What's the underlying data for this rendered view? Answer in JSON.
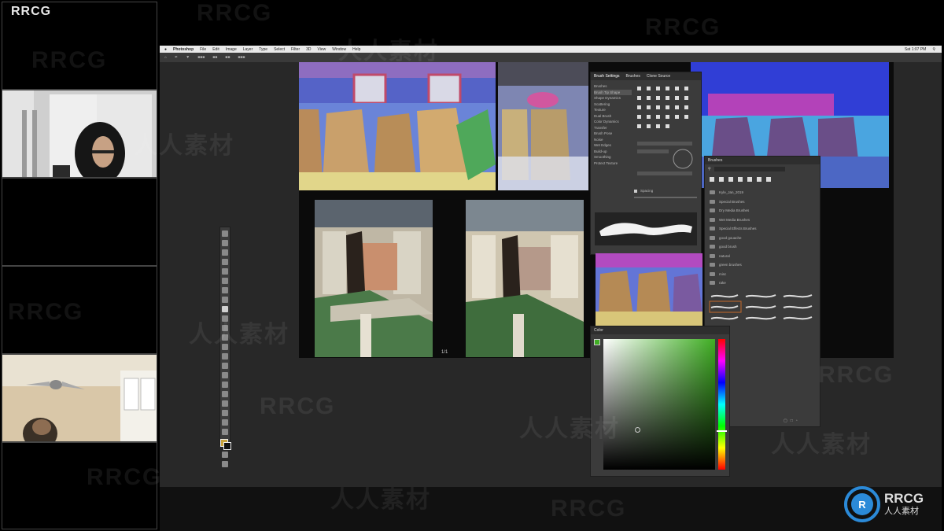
{
  "brand": {
    "top_left": "RRCG",
    "logo_title": "RRCG",
    "logo_subtitle": "人人素材"
  },
  "watermarks": [
    "RRCG",
    "人人素材"
  ],
  "ps": {
    "menu": [
      "Photoshop",
      "File",
      "Edit",
      "Image",
      "Layer",
      "Type",
      "Select",
      "Filter",
      "3D",
      "View",
      "Window",
      "Help"
    ],
    "clock": "Sat 1:07 PM"
  },
  "brush_settings_panel": {
    "tabs": [
      "Brush Settings",
      "Brushes",
      "Clone Source"
    ],
    "sections": [
      "Brushes",
      "Brush Tip Shape",
      "Shape Dynamics",
      "Scattering",
      "Texture",
      "Dual Brush",
      "Color Dynamics",
      "Transfer",
      "Brush Pose",
      "Noise",
      "Wet Edges",
      "Build-up",
      "Smoothing",
      "Protect Texture"
    ],
    "spacing_label": "Spacing"
  },
  "brushes_panel": {
    "title": "Brushes",
    "folders": [
      "Kyle_Jan_2019",
      "Special Brushes",
      "Dry Media Brushes",
      "Wet Media Brushes",
      "Special Effects Brushes",
      "good gouache",
      "good brush",
      "natural",
      "green brushes",
      "misc",
      "rake"
    ]
  },
  "color_panel": {
    "title": "Color"
  },
  "canvas": {
    "page_indicator": "1/1"
  },
  "colors": {
    "accent": "#2b8ad8",
    "hue_top": "#ff0000",
    "field": "#3fae23"
  }
}
